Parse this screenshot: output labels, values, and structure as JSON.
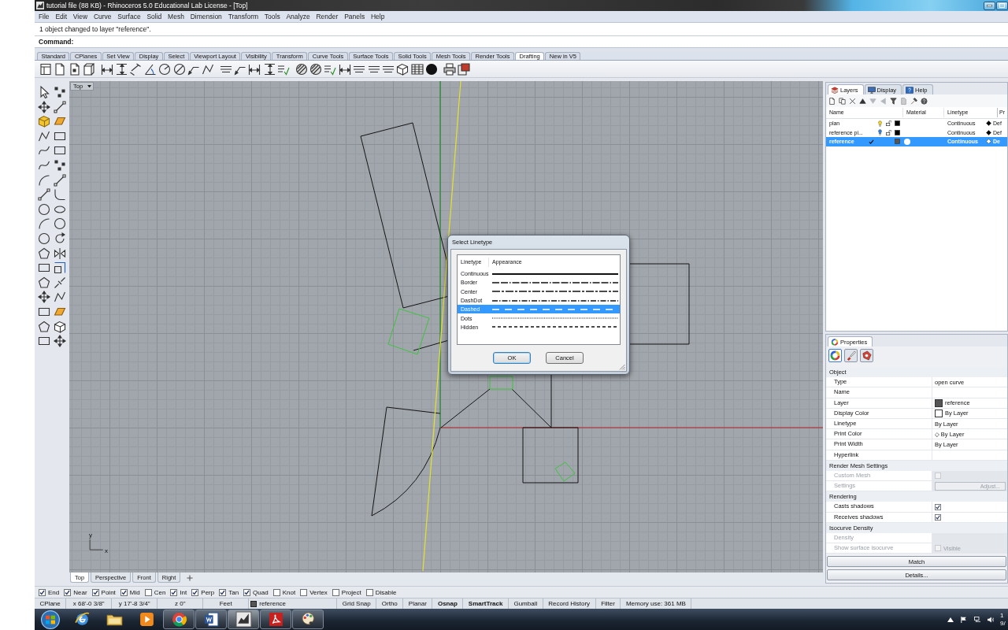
{
  "window": {
    "title": "tutorial file (88 KB) - Rhinoceros 5.0 Educational Lab License - [Top]"
  },
  "menu": [
    "File",
    "Edit",
    "View",
    "Curve",
    "Surface",
    "Solid",
    "Mesh",
    "Dimension",
    "Transform",
    "Tools",
    "Analyze",
    "Render",
    "Panels",
    "Help"
  ],
  "command": {
    "history": "1 object changed to layer \"reference\".",
    "prompt": "Command:"
  },
  "toolbar_tabs": [
    {
      "label": "Standard",
      "selected": false
    },
    {
      "label": "CPlanes",
      "selected": false
    },
    {
      "label": "Set View",
      "selected": false
    },
    {
      "label": "Display",
      "selected": false
    },
    {
      "label": "Select",
      "selected": false
    },
    {
      "label": "Viewport Layout",
      "selected": false
    },
    {
      "label": "Visibility",
      "selected": false
    },
    {
      "label": "Transform",
      "selected": false
    },
    {
      "label": "Curve Tools",
      "selected": false
    },
    {
      "label": "Surface Tools",
      "selected": false
    },
    {
      "label": "Solid Tools",
      "selected": false
    },
    {
      "label": "Mesh Tools",
      "selected": false
    },
    {
      "label": "Render Tools",
      "selected": false
    },
    {
      "label": "Drafting",
      "selected": true
    },
    {
      "label": "New in V5",
      "selected": false
    }
  ],
  "viewport": {
    "title": "Top",
    "axis_icon": {
      "y_label": "y",
      "x_label": "x"
    }
  },
  "dialog": {
    "title": "Select Linetype",
    "columns": [
      "Linetype",
      "Appearance"
    ],
    "rows": [
      {
        "name": "Continuous",
        "kind": "continuous",
        "selected": false
      },
      {
        "name": "Border",
        "kind": "border",
        "selected": false
      },
      {
        "name": "Center",
        "kind": "center",
        "selected": false
      },
      {
        "name": "DashDot",
        "kind": "dashdot",
        "selected": false
      },
      {
        "name": "Dashed",
        "kind": "dashed",
        "selected": true
      },
      {
        "name": "Dots",
        "kind": "dots",
        "selected": false
      },
      {
        "name": "Hidden",
        "kind": "hidden",
        "selected": false
      }
    ],
    "buttons": [
      {
        "label": "OK",
        "default": true
      },
      {
        "label": "Cancel",
        "default": false
      }
    ]
  },
  "viewport_tabs": [
    {
      "label": "Top",
      "selected": true
    },
    {
      "label": "Perspective",
      "selected": false
    },
    {
      "label": "Front",
      "selected": false
    },
    {
      "label": "Right",
      "selected": false
    }
  ],
  "layers_panel": {
    "tabs": [
      {
        "label": "Layers",
        "kind": "layers",
        "selected": true
      },
      {
        "label": "Display",
        "kind": "display",
        "selected": false
      },
      {
        "label": "Help",
        "kind": "help",
        "selected": false
      }
    ],
    "columns": [
      "Name",
      "Material",
      "Linetype",
      "Pr"
    ],
    "rows": [
      {
        "name": "plan",
        "selected": false,
        "current": false,
        "light": {
          "color": "#f2d21c"
        },
        "lock_icon": true,
        "layer": {
          "color": "#000000"
        },
        "linetype": "Continuous",
        "print_color": {
          "color": "#000000",
          "label": "Def"
        }
      },
      {
        "name": "reference pi...",
        "selected": false,
        "current": false,
        "light": {
          "color": "#2f80d6"
        },
        "lock_icon": true,
        "layer": {
          "color": "#000000"
        },
        "linetype": "Continuous",
        "print_color": {
          "color": "#000000",
          "label": "Def"
        }
      },
      {
        "name": "reference",
        "selected": true,
        "current": true,
        "lock_icon": false,
        "layer": {
          "color": "#555555"
        },
        "linetype": "Continuous",
        "print_color": {
          "color": "#ffffff",
          "label": "De"
        }
      }
    ]
  },
  "properties_panel": {
    "tab": "Properties",
    "pages": [
      {
        "kind": "object",
        "selected": true
      },
      {
        "kind": "material",
        "selected": false
      },
      {
        "kind": "decal",
        "selected": false
      }
    ],
    "sections": [
      {
        "title": "Object",
        "rows": [
          {
            "label": "Type",
            "kind": "text",
            "value": "open curve",
            "disabled": false
          },
          {
            "label": "Name",
            "kind": "text",
            "disabled": false
          },
          {
            "label": "Layer",
            "kind": "swatch",
            "value": "reference",
            "color": "#555555",
            "disabled": false
          },
          {
            "label": "Display Color",
            "kind": "swatch",
            "value": "By Layer",
            "color": "#ffffff",
            "disabled": false
          },
          {
            "label": "Linetype",
            "kind": "text",
            "value": "By Layer",
            "disabled": false
          },
          {
            "label": "Print Color",
            "kind": "text",
            "value": "◇ By Layer",
            "disabled": false
          },
          {
            "label": "Print Width",
            "kind": "text",
            "value": "By Layer",
            "disabled": false
          },
          {
            "label": "Hyperlink",
            "kind": "text",
            "disabled": false
          }
        ]
      },
      {
        "title": "Render Mesh Settings",
        "rows": [
          {
            "label": "Custom Mesh",
            "kind": "checkbox",
            "checked": false,
            "disabled": true
          },
          {
            "label": "Settings",
            "kind": "button",
            "value": "Adjust...",
            "disabled": true
          }
        ]
      },
      {
        "title": "Rendering",
        "rows": [
          {
            "label": "Casts shadows",
            "kind": "checkbox",
            "checked": true,
            "disabled": false
          },
          {
            "label": "Receives shadows",
            "kind": "checkbox",
            "checked": true,
            "disabled": false
          }
        ]
      },
      {
        "title": "Isocurve Density",
        "rows": [
          {
            "label": "Density",
            "kind": "text",
            "disabled": true
          },
          {
            "label": "Show surface isocurve",
            "kind": "checkbox",
            "value": "Visible",
            "checked": false,
            "disabled": true
          }
        ]
      }
    ],
    "buttons": [
      "Match",
      "Details..."
    ]
  },
  "osnaps": [
    {
      "label": "End",
      "checked": true
    },
    {
      "label": "Near",
      "checked": true
    },
    {
      "label": "Point",
      "checked": true
    },
    {
      "label": "Mid",
      "checked": true
    },
    {
      "label": "Cen",
      "checked": false
    },
    {
      "label": "Int",
      "checked": true
    },
    {
      "label": "Perp",
      "checked": true
    },
    {
      "label": "Tan",
      "checked": true
    },
    {
      "label": "Quad",
      "checked": true
    },
    {
      "label": "Knot",
      "checked": false
    },
    {
      "label": "Vertex",
      "checked": false
    },
    {
      "label": "Project",
      "checked": false
    },
    {
      "label": "Disable",
      "checked": false
    }
  ],
  "status_bar": [
    {
      "text": "CPlane",
      "kind": "text"
    },
    {
      "text": "x 68'-0 3/8\"",
      "kind": "text"
    },
    {
      "text": "y 17'-8 3/4\"",
      "kind": "text"
    },
    {
      "text": "z 0\"",
      "kind": "text"
    },
    {
      "text": "Feet",
      "kind": "text"
    },
    {
      "text": "reference",
      "kind": "layer",
      "color": "#555555"
    },
    {
      "text": "Grid Snap",
      "kind": "toggle",
      "on": false
    },
    {
      "text": "Ortho",
      "kind": "toggle",
      "on": false
    },
    {
      "text": "Planar",
      "kind": "toggle",
      "on": false
    },
    {
      "text": "Osnap",
      "kind": "toggle",
      "on": true
    },
    {
      "text": "SmartTrack",
      "kind": "toggle",
      "on": true
    },
    {
      "text": "Gumball",
      "kind": "toggle",
      "on": false
    },
    {
      "text": "Record History",
      "kind": "toggle",
      "on": false
    },
    {
      "text": "Filter",
      "kind": "toggle",
      "on": false
    },
    {
      "text": "Memory use: 361 MB",
      "kind": "text"
    }
  ],
  "taskbar": {
    "apps": [
      {
        "kind": "globe",
        "running": false,
        "active": false
      },
      {
        "kind": "folder",
        "running": false,
        "active": false
      },
      {
        "kind": "player",
        "running": false,
        "active": false
      },
      {
        "kind": "ring",
        "running": true,
        "active": false
      },
      {
        "kind": "doc",
        "running": true,
        "active": false
      },
      {
        "kind": "cad",
        "running": true,
        "active": true
      },
      {
        "kind": "pdf",
        "running": true,
        "active": false
      },
      {
        "kind": "palette",
        "running": true,
        "active": false
      }
    ],
    "clock": {
      "time": "1",
      "date": "9/"
    }
  }
}
